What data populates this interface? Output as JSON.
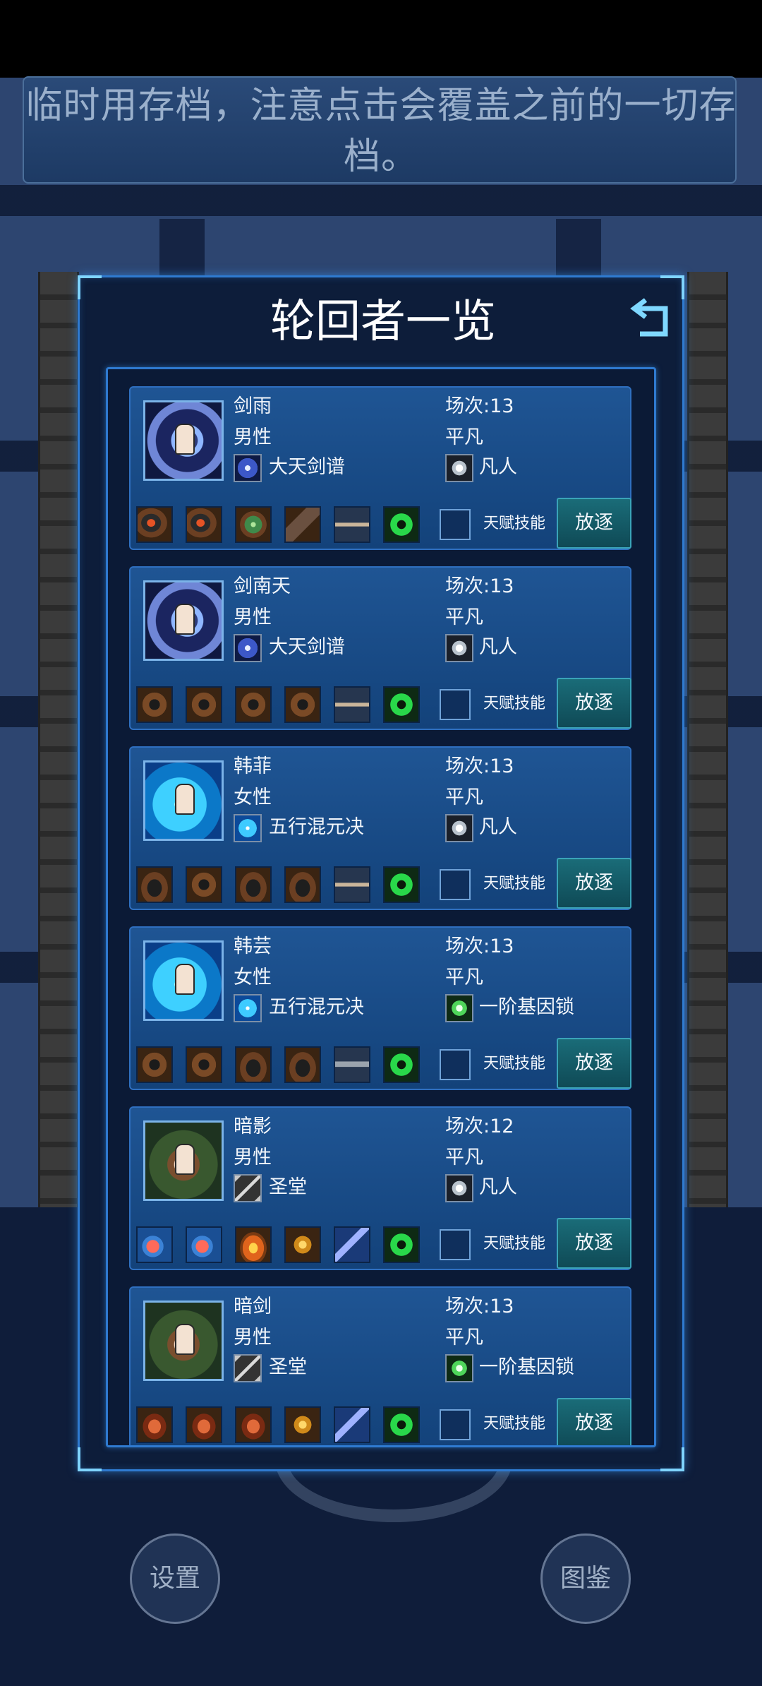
{
  "notice": {
    "text": "临时用存档，注意点击会覆盖之前的一切存档。"
  },
  "panel": {
    "title": "轮回者一览",
    "back_icon": "back-arrow-icon"
  },
  "labels": {
    "talent_skill": "天赋技能",
    "exile": "放逐"
  },
  "colors": {
    "panel_border": "#2f7ad0",
    "card_bg": "#1f5594",
    "exile_bg": "#1a6c78",
    "title_text": "#ffffff"
  },
  "characters": [
    {
      "name": "剑雨",
      "gender": "男性",
      "skill": "大天剑谱",
      "scene": "场次:13",
      "rank": "平凡",
      "talent": "凡人",
      "portrait": "sword-spirit-portrait",
      "equipment": [
        "helmet-red-icon",
        "helmet-red-icon",
        "leaf-icon",
        "glove-icon",
        "gun-icon",
        "dna-icon"
      ]
    },
    {
      "name": "剑南天",
      "gender": "男性",
      "skill": "大天剑谱",
      "scene": "场次:13",
      "rank": "平凡",
      "talent": "凡人",
      "portrait": "sword-spirit-portrait",
      "equipment": [
        "goggles-icon",
        "goggles-icon",
        "goggles-icon",
        "goggles-icon",
        "gun-icon",
        "dna-icon"
      ]
    },
    {
      "name": "韩菲",
      "gender": "女性",
      "skill": "五行混元决",
      "scene": "场次:13",
      "rank": "平凡",
      "talent": "凡人",
      "portrait": "water-spirit-portrait",
      "equipment": [
        "helmet-icon",
        "goggles-icon",
        "helmet-icon",
        "helmet-icon",
        "gun-icon",
        "dna-icon"
      ]
    },
    {
      "name": "韩芸",
      "gender": "女性",
      "skill": "五行混元决",
      "scene": "场次:13",
      "rank": "平凡",
      "talent": "一阶基因锁",
      "portrait": "water-spirit-portrait",
      "equipment": [
        "goggles-icon",
        "goggles-icon",
        "helmet-icon",
        "helmet-icon",
        "rifle-icon",
        "dna-icon"
      ]
    },
    {
      "name": "暗影",
      "gender": "男性",
      "skill": "圣堂",
      "scene": "场次:12",
      "rank": "平凡",
      "talent": "凡人",
      "portrait": "forest-warrior-portrait",
      "equipment": [
        "potion-icon",
        "potion-icon",
        "fire-icon",
        "bolt-icon",
        "blade-icon",
        "dna-icon"
      ]
    },
    {
      "name": "暗剑",
      "gender": "男性",
      "skill": "圣堂",
      "scene": "场次:13",
      "rank": "平凡",
      "talent": "一阶基因锁",
      "portrait": "forest-warrior-portrait",
      "equipment": [
        "ore-icon",
        "ore-icon",
        "ore-icon",
        "bolt-icon",
        "blade-icon",
        "dna-icon"
      ]
    }
  ],
  "bottom_buttons": {
    "settings": "设置",
    "codex": "图鉴"
  }
}
